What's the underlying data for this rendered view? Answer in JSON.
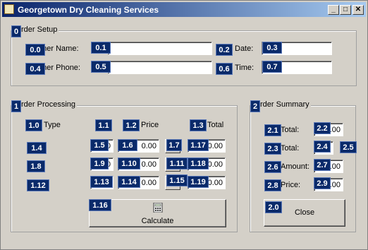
{
  "window": {
    "title": "Georgetown Dry Cleaning Services",
    "minimize": "_",
    "maximize": "□",
    "close": "✕"
  },
  "order_setup": {
    "title": "rder Setup",
    "customer_name_label": "omer Name:",
    "customer_phone_label": "omer Phone:",
    "date_label": "Date:",
    "time_label": "Time:",
    "customer_name_value": "",
    "customer_phone_value": "",
    "date_value": "",
    "time_value": ""
  },
  "order_processing": {
    "title": "rder Processing",
    "type_label": "Type",
    "price_label": "Price",
    "total_label": "Total",
    "row1_qty": "0",
    "row1_price": "0.00",
    "row1_total": "0.00",
    "row2_qty": "0",
    "row2_price": "0.00",
    "row2_total": "0.00",
    "row3_qty": "0",
    "row3_price": "0.00",
    "row3_total": "0.00",
    "calculate_label": "Calculate"
  },
  "order_summary": {
    "title": "rder Summary",
    "subtotal_label": "Total:",
    "tax_label": "Total:",
    "amount_label": "Amount:",
    "price_label": "Price:",
    "subtotal_value": "0.00",
    "tax_rate_value": "5",
    "amount_value": "0.00",
    "price_value": "0.00",
    "close_label": "Close"
  },
  "badges": [
    "0",
    "0.0",
    "0.1",
    "0.2",
    "0.3",
    "0.4",
    "0.5",
    "0.6",
    "0.7",
    "1",
    "1.0",
    "1.1",
    "1.2",
    "1.3",
    "1.4",
    "1.5",
    "1.6",
    "1.7",
    "1.8",
    "1.9",
    "1.10",
    "1.11",
    "1.12",
    "1.13",
    "1.14",
    "1.15",
    "1.16",
    "1.17",
    "1.18",
    "1.19",
    "2",
    "2.0",
    "2.1",
    "2.2",
    "2.3",
    "2.4",
    "2.5",
    "2.6",
    "2.7",
    "2.8",
    "2.9"
  ],
  "icons": {
    "calculator": "calculator-icon",
    "app": "app-icon"
  }
}
